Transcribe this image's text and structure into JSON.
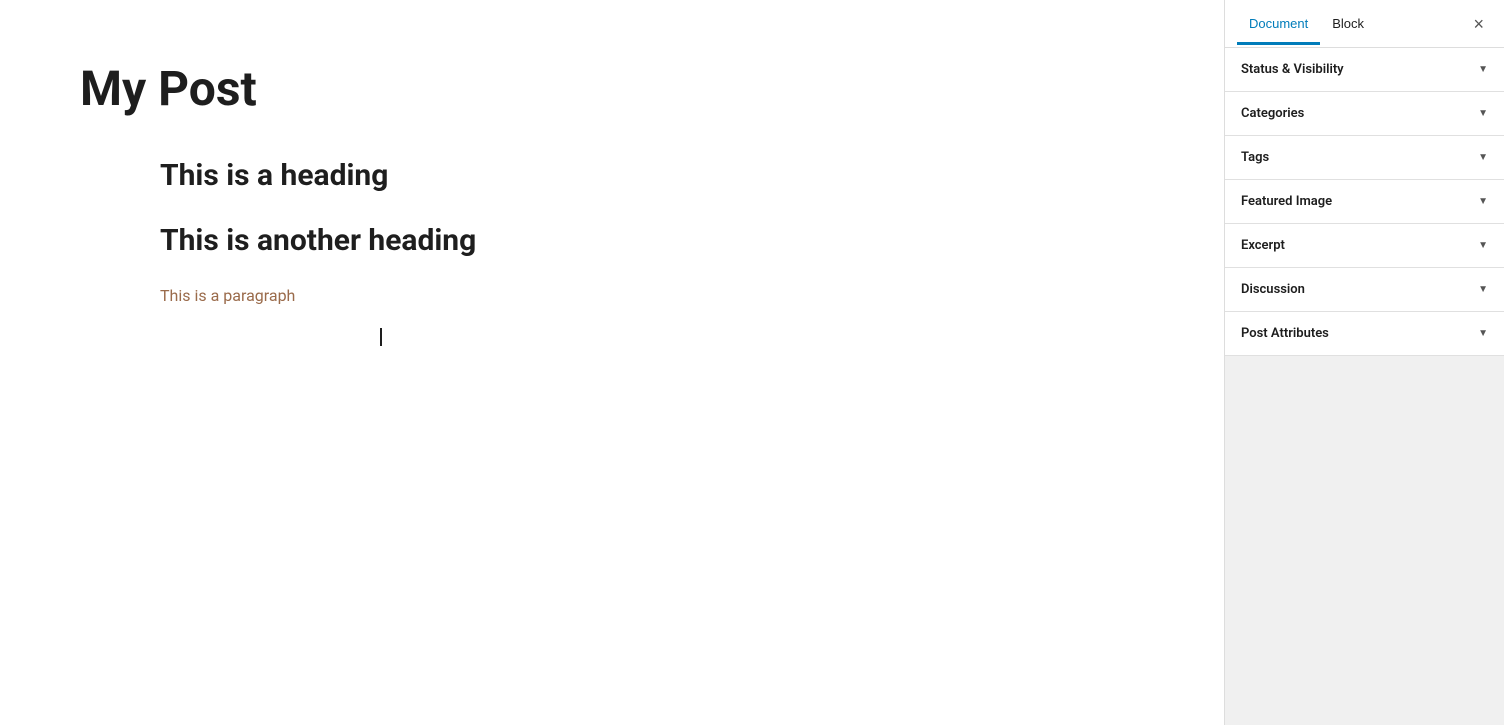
{
  "editor": {
    "post_title": "My Post",
    "heading_1": "This is a heading",
    "heading_2": "This is another heading",
    "paragraph": "This is a paragraph"
  },
  "sidebar": {
    "tab_document": "Document",
    "tab_block": "Block",
    "close_label": "×",
    "sections": [
      {
        "id": "status-visibility",
        "label": "Status & Visibility"
      },
      {
        "id": "categories",
        "label": "Categories"
      },
      {
        "id": "tags",
        "label": "Tags"
      },
      {
        "id": "featured-image",
        "label": "Featured Image"
      },
      {
        "id": "excerpt",
        "label": "Excerpt"
      },
      {
        "id": "discussion",
        "label": "Discussion"
      },
      {
        "id": "post-attributes",
        "label": "Post Attributes"
      }
    ]
  }
}
